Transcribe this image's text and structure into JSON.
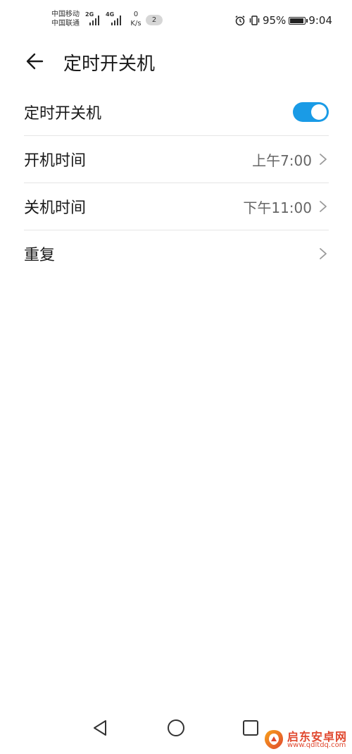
{
  "status_bar": {
    "carrier_1": "中国移动",
    "carrier_2": "中国联通",
    "network_1": "2G",
    "network_2": "4G",
    "speed_value": "0",
    "speed_unit": "K/s",
    "notification_count": "2",
    "battery_percent": "95%",
    "time": "9:04",
    "icons": [
      "alarm-icon",
      "vibrate-icon",
      "battery-icon"
    ]
  },
  "header": {
    "back_icon": "arrow-left-icon",
    "title": "定时开关机"
  },
  "settings": {
    "items": [
      {
        "label": "定时开关机",
        "type": "toggle",
        "enabled": true
      },
      {
        "label": "开机时间",
        "value": "上午7:00"
      },
      {
        "label": "关机时间",
        "value": "下午11:00"
      },
      {
        "label": "重复",
        "value": ""
      }
    ]
  },
  "nav_bar": {
    "buttons": [
      "back-triangle-icon",
      "home-circle-icon",
      "recents-square-icon"
    ]
  },
  "watermark": {
    "name": "启东安卓网",
    "url": "www.qdltdq.com"
  },
  "colors": {
    "accent": "#1a9be6",
    "watermark": "#e0482f"
  }
}
